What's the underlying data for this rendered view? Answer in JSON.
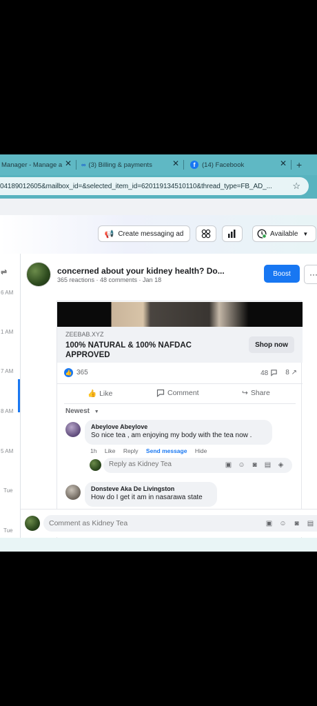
{
  "tabs": [
    {
      "label": "Manager - Manage a",
      "close": "✕"
    },
    {
      "label": "(3) Billing & payments",
      "close": "✕"
    },
    {
      "label": "(14) Facebook",
      "close": "✕"
    }
  ],
  "new_tab": "+",
  "url": "04189012605&mailbox_id=&selected_item_id=620119134510110&thread_type=FB_AD_...",
  "toolbar": {
    "create_ad": "Create messaging ad",
    "status": "Available"
  },
  "timestamps": [
    "6 AM",
    "1 AM",
    "7 AM",
    "8 AM",
    "5 AM",
    "Tue",
    "Tue"
  ],
  "post": {
    "title": "concerned about your kidney health? Do...",
    "meta": "365 reactions · 48 comments · Jan 18",
    "boost": "Boost",
    "more": "···",
    "ad_domain": "ZEEBAB.XYZ",
    "ad_headline": "100% NATURAL & 100% NAFDAC APPROVED",
    "shop_now": "Shop now",
    "reactions": "365",
    "comments_count": "48",
    "shares_count": "8",
    "like": "Like",
    "comment": "Comment",
    "share": "Share",
    "sort": "Newest"
  },
  "comments": [
    {
      "name": "Abeylove Abeylove",
      "text": "So nice tea , am enjoying my body with the tea now .",
      "time": "1h",
      "like": "Like",
      "reply": "Reply",
      "send_message": "Send message",
      "hide": "Hide"
    },
    {
      "name": "Donsteve Aka De Livingston",
      "text": "How do I get it am in nasarawa state"
    }
  ],
  "reply_placeholder": "Reply as Kidney Tea",
  "comment_placeholder": "Comment as Kidney Tea",
  "colors": {
    "accent": "#1877f2",
    "tabbar": "#5fb8c4"
  }
}
